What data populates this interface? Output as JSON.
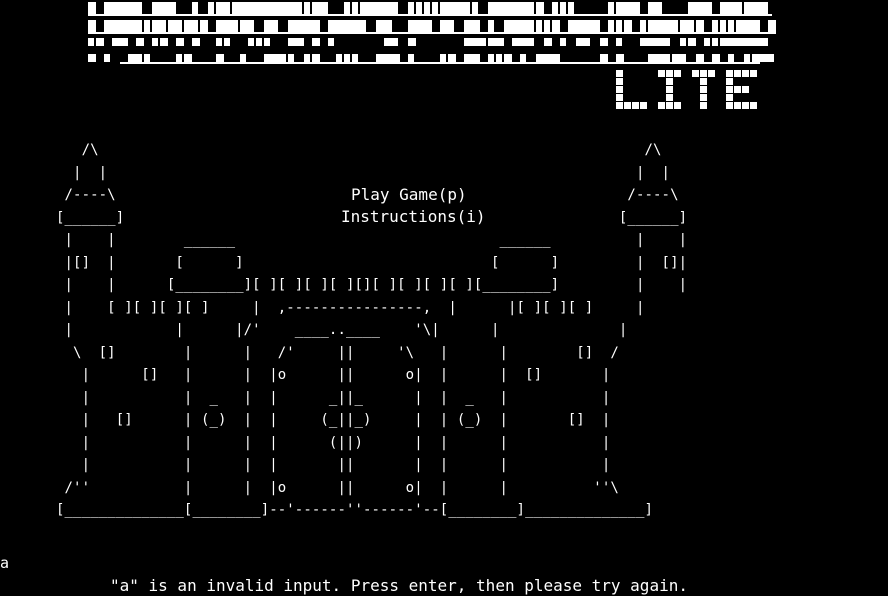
{
  "logo": {
    "subtitle": "LITE",
    "color": "#ffffff"
  },
  "castle_art": [
    "   /\\                                                                /\\",
    "  |  |                                                              |  |",
    " /----\\                                                            /----\\",
    "[______]                                                          [______]",
    " |    |        ______                               ______          |    |",
    " |[]  |       [      ]                             [      ]         |  []|",
    " |    |      [________][ ][ ][ ][ ][][ ][ ][ ][ ][________]         |    |",
    " |    [ ][ ][ ][ ]     |  ,----------------,  |      |[ ][ ][ ]     |",
    " |            |      |/'    ____..____    '\\|      |              |",
    "  \\  []        |      |   /'     ||     '\\   |      |        []  /",
    "   |      []   |      |  |o      ||      o|  |      |  []       |",
    "   |           |  _   |  |      _||_      |  |  _   |           |",
    "   |   []      | (_)  |  |     (_||_)     |  | (_)  |       []  |",
    "   |           |      |  |      (||)      |  |      |           |",
    "   |           |      |  |       ||       |  |      |           |",
    " /''           |      |  |o      ||      o|  |      |          ''\\",
    "[______________[________]--'------''------'--[________]______________]"
  ],
  "menu": {
    "play_label": "Play Game(p)",
    "instructions_label": "Instructions(i)"
  },
  "console": {
    "user_input": "a",
    "error_message": "\"a\" is an invalid input. Press enter, then please try again."
  }
}
